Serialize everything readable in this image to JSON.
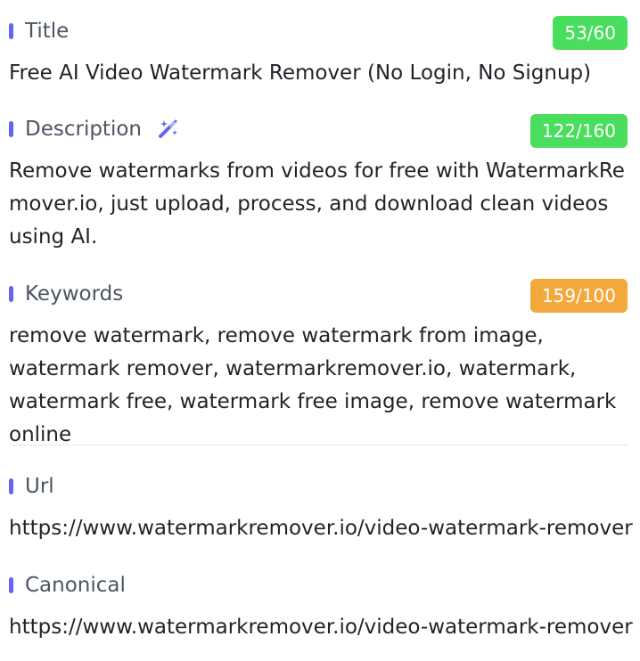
{
  "title_section": {
    "label": "Title",
    "count": "53/60",
    "value": "Free AI Video Watermark Remover (No Login, No Signup)"
  },
  "description_section": {
    "label": "Description",
    "icon": "magic-wand-icon",
    "count": "122/160",
    "value": "Remove watermarks from videos for free with WatermarkRemover.io, just upload, process, and download clean videos using AI."
  },
  "keywords_section": {
    "label": "Keywords",
    "count": "159/100",
    "value": "remove watermark, remove watermark from image, watermark remover, watermarkremover.io, watermark, watermark free, watermark free image, remove watermark online"
  },
  "url_section": {
    "label": "Url",
    "value": "https://www.watermarkremover.io/video-watermark-remover"
  },
  "canonical_section": {
    "label": "Canonical",
    "value": "https://www.watermarkremover.io/video-watermark-remover"
  },
  "colors": {
    "accent": "#6366f1",
    "badge_ok": "#4ade5e",
    "badge_warn": "#f3a83c"
  }
}
